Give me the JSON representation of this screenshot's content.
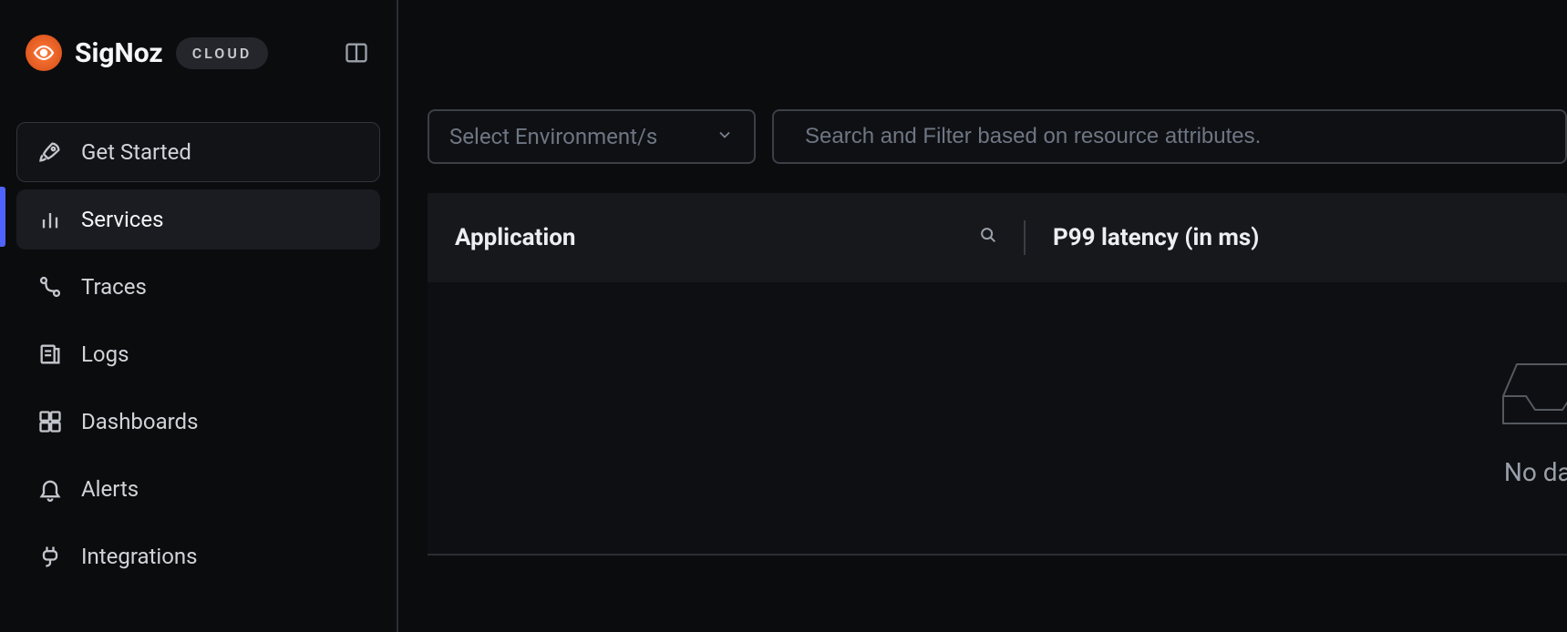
{
  "brand": {
    "name": "SigNoz",
    "badge": "CLOUD"
  },
  "sidebar": {
    "items": [
      {
        "label": "Get Started"
      },
      {
        "label": "Services"
      },
      {
        "label": "Traces"
      },
      {
        "label": "Logs"
      },
      {
        "label": "Dashboards"
      },
      {
        "label": "Alerts"
      },
      {
        "label": "Integrations"
      }
    ]
  },
  "filters": {
    "environment_placeholder": "Select Environment/s",
    "search_placeholder": "Search and Filter based on resource attributes."
  },
  "table": {
    "columns": {
      "application": "Application",
      "p99": "P99 latency (in ms)"
    },
    "empty_text": "No data"
  }
}
